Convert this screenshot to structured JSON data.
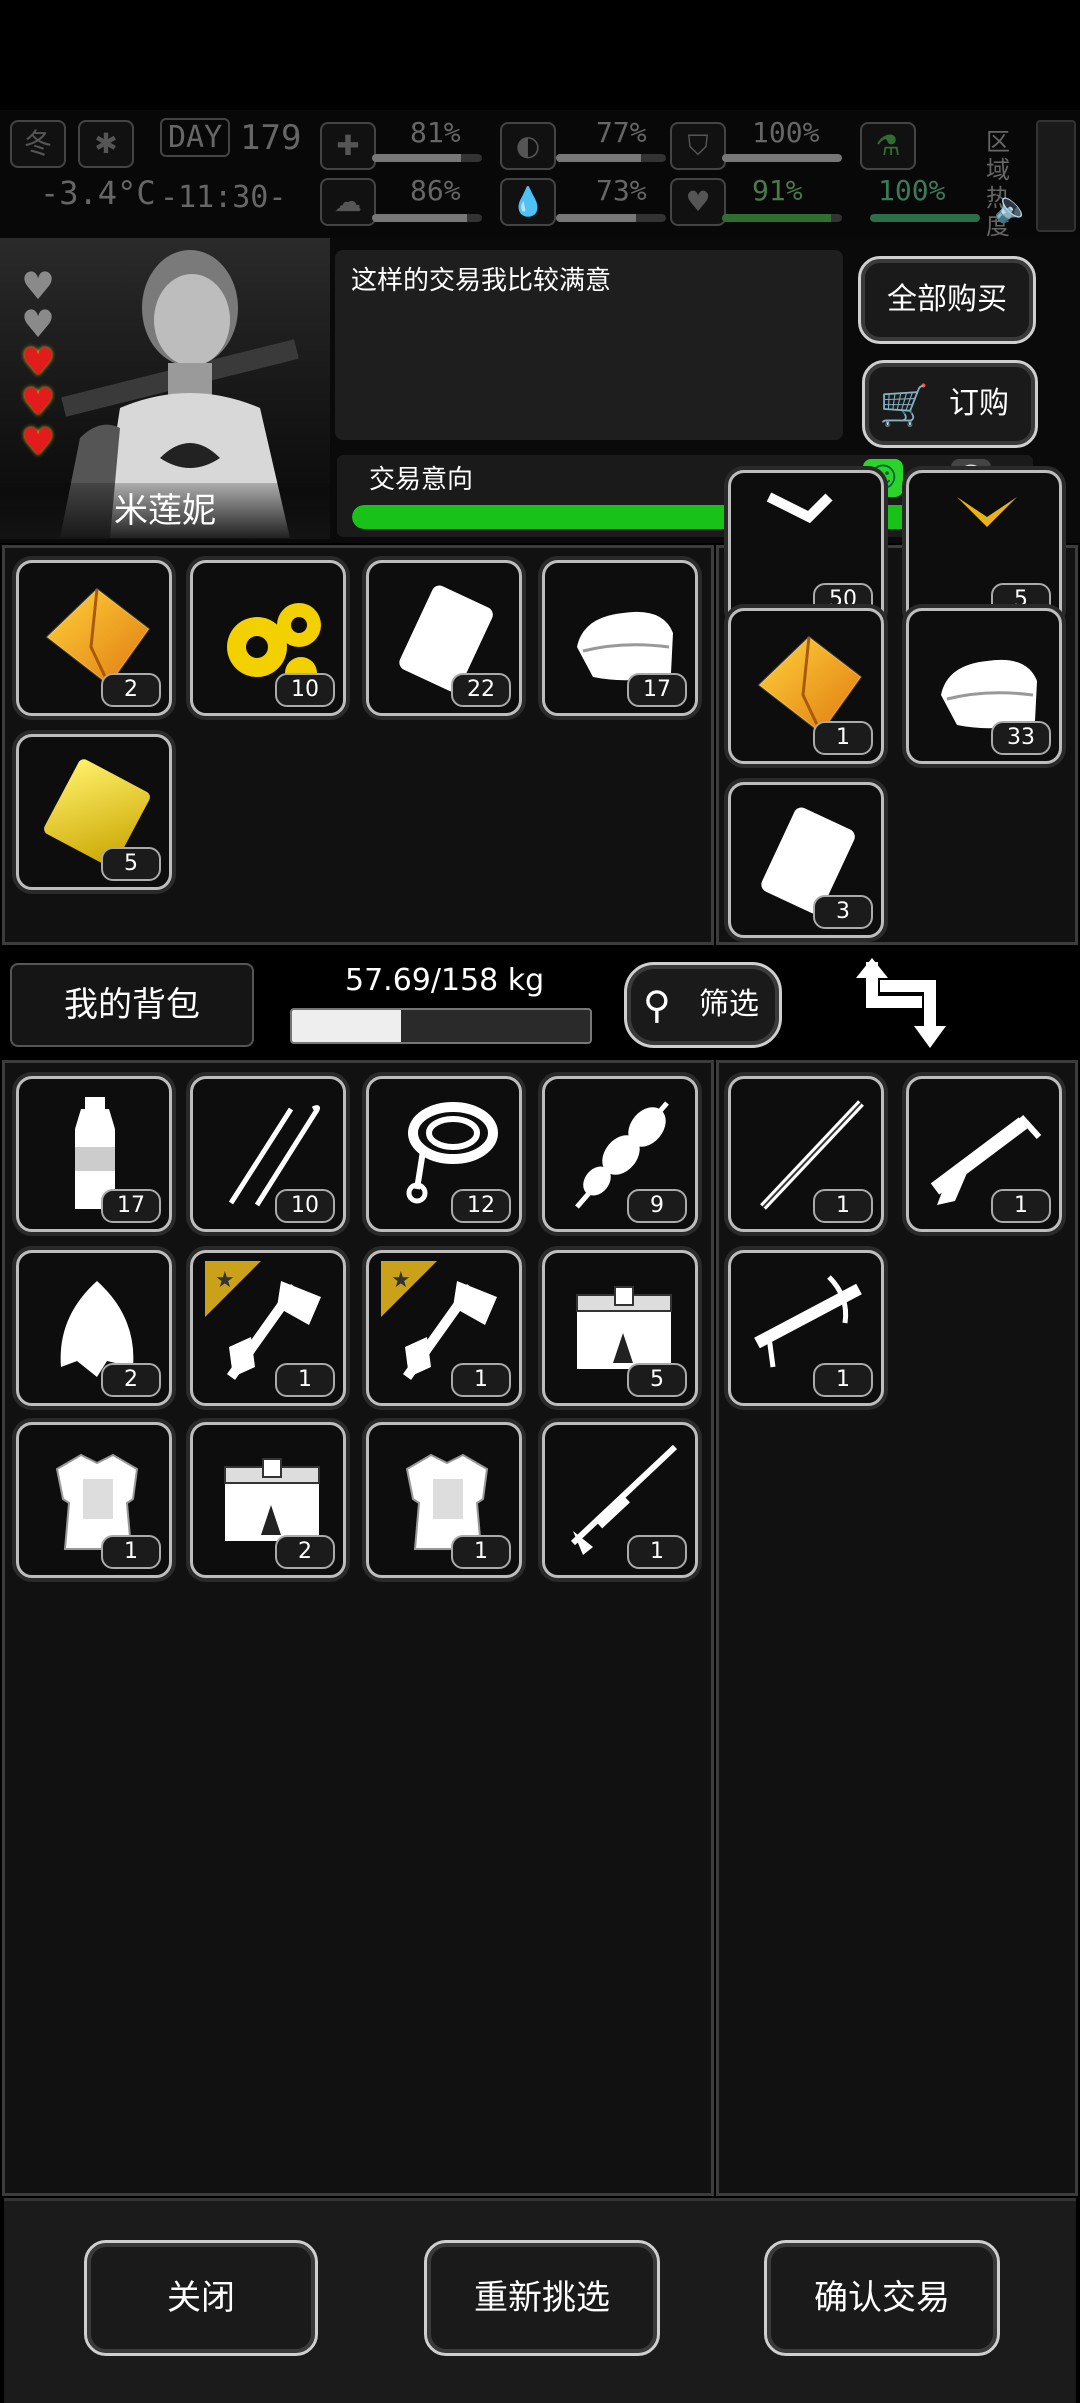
{
  "hud": {
    "season": "冬",
    "day_label": "DAY",
    "day": "179",
    "temp": "-3.4°C",
    "time": "-11:30-",
    "stats": [
      {
        "name": "health",
        "value": "81%",
        "fill": 0.81
      },
      {
        "name": "hunger",
        "value": "77%",
        "fill": 0.77
      },
      {
        "name": "shield",
        "value": "100%",
        "fill": 1.0
      },
      {
        "name": "brain",
        "value": "86%",
        "fill": 0.86
      },
      {
        "name": "water",
        "value": "73%",
        "fill": 0.73
      },
      {
        "name": "heart",
        "value": "91%",
        "fill": 0.91
      },
      {
        "name": "energy",
        "value": "100%",
        "fill": 1.0
      }
    ],
    "zone_label": "区域热度"
  },
  "trader": {
    "name": "米莲妮",
    "speech": "这样的交易我比较满意",
    "hearts_red": 3,
    "hearts_gray": 2,
    "buy_all_label": "全部购买",
    "order_label": "订购",
    "intent_label": "交易意向",
    "intent_value": 0.92
  },
  "merchant_items": [
    {
      "icon": "gold-ore-icon",
      "count": "2"
    },
    {
      "icon": "gears-icon",
      "count": "10"
    },
    {
      "icon": "plastic-sheet-icon",
      "count": "22"
    },
    {
      "icon": "cloth-icon",
      "count": "17"
    },
    {
      "icon": "gold-bar-icon",
      "count": "5"
    }
  ],
  "offer_items": [
    {
      "icon": "scrap-icon",
      "count": "50"
    },
    {
      "icon": "gold-scrap-icon",
      "count": "5"
    },
    {
      "icon": "gold-ore-icon",
      "count": "1"
    },
    {
      "icon": "cloth-icon",
      "count": "33"
    },
    {
      "icon": "plastic-sheet-icon",
      "count": "3"
    }
  ],
  "inventory": {
    "title": "我的背包",
    "weight": "57.69/158 kg",
    "weight_fill": 0.365,
    "filter_label": "筛选"
  },
  "backpack_items": [
    {
      "icon": "water-bottle-icon",
      "count": "17"
    },
    {
      "icon": "lockpick-icon",
      "count": "10"
    },
    {
      "icon": "rope-icon",
      "count": "12"
    },
    {
      "icon": "skewer-icon",
      "count": "9"
    },
    {
      "icon": "cloth-scrap-icon",
      "count": "2"
    },
    {
      "icon": "hatchet-icon",
      "count": "1",
      "starred": true
    },
    {
      "icon": "hatchet-icon",
      "count": "1",
      "starred": true
    },
    {
      "icon": "crate-icon",
      "count": "5"
    },
    {
      "icon": "body-armor-icon",
      "count": "1"
    },
    {
      "icon": "crate-icon",
      "count": "2"
    },
    {
      "icon": "body-armor-icon",
      "count": "1"
    },
    {
      "icon": "sniper-rifle-icon",
      "count": "1"
    }
  ],
  "equipped_items": [
    {
      "icon": "staff-icon",
      "count": "1"
    },
    {
      "icon": "shotgun-icon",
      "count": "1"
    },
    {
      "icon": "crossbow-icon",
      "count": "1"
    }
  ],
  "buttons": {
    "close": "关闭",
    "reselect": "重新挑选",
    "confirm": "确认交易"
  }
}
